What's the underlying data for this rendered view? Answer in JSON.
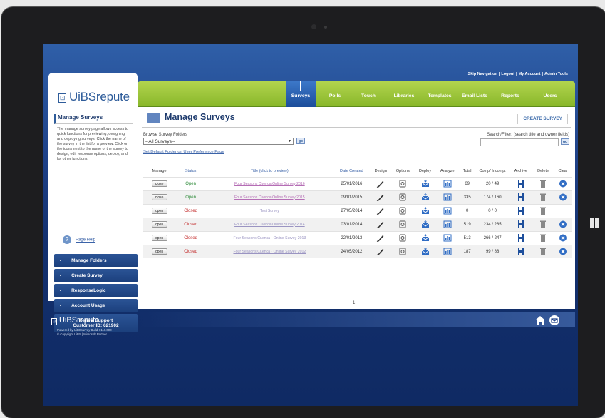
{
  "device": {
    "camera": "camera-dot",
    "os_logo": "windows-logo-icon"
  },
  "top_links": [
    "Skip Navigation",
    "Logout",
    "My Account",
    "Admin Tools"
  ],
  "logo": {
    "text": "UiBSrepute"
  },
  "nav": {
    "items": [
      "Surveys",
      "Polls",
      "Touch",
      "Libraries",
      "Templates",
      "Email Lists",
      "Reports",
      "Users"
    ],
    "active": "Surveys"
  },
  "sidebar": {
    "title": "Manage Surveys",
    "description": "The manage survey page allows access to quick functions for previewing, designing and deploying surveys. Click the name of the survey in the list for a preview. Click on the icons next to the name of the survey to design, edit response options, deploy, and for other functions.",
    "help": "Page Help",
    "menu": [
      "Manage Folders",
      "Create Survey",
      "ResponseLogic",
      "Account Usage"
    ],
    "renew": {
      "label": "Renew Support",
      "customer": "Customer ID: 621902"
    }
  },
  "main": {
    "title": "Manage Surveys",
    "create_button": "CREATE SURVEY",
    "browse_label": "Browse Survey Folders",
    "folder_select": "--All Surveys--",
    "go_label": "go",
    "set_default": "Set Default Folder on User Preference Page",
    "search_label": "Search/Filter: (search title and owner fields)"
  },
  "table": {
    "headers": {
      "manage": "Manage",
      "status": "Status",
      "title": "Title (click to preview)",
      "date": "Date Created",
      "design": "Design",
      "options": "Options",
      "deploy": "Deploy",
      "analyze": "Analyze",
      "total": "Total",
      "comp": "Comp/ Incomp.",
      "archive": "Archive",
      "delete": "Delete",
      "clear": "Clear"
    },
    "rows": [
      {
        "manage": "close",
        "status": "Open",
        "title": "Four Seasons Cuenca Online Survey 2016",
        "date": "25/01/2016",
        "total": "69",
        "comp": "20 / 49",
        "clear": true
      },
      {
        "manage": "close",
        "status": "Open",
        "title": "Four Seasons Cuenca Online Survey 2015",
        "date": "09/01/2015",
        "total": "335",
        "comp": "174 / 160",
        "clear": true
      },
      {
        "manage": "open",
        "status": "Closed",
        "title": "Test Survey",
        "date": "27/05/2014",
        "total": "0",
        "comp": "0 / 0",
        "clear": false
      },
      {
        "manage": "open",
        "status": "Closed",
        "title": "Four Seasons Cuenca Online Survey 2014",
        "date": "03/01/2014",
        "total": "519",
        "comp": "234 / 285",
        "clear": true
      },
      {
        "manage": "open",
        "status": "Closed",
        "title": "Four Seasons Cuenca - Online Survey 2013",
        "date": "22/01/2013",
        "total": "513",
        "comp": "266 / 247",
        "clear": true
      },
      {
        "manage": "open",
        "status": "Closed",
        "title": "Four Seasons Cuenca - Online Survey 2012",
        "date": "24/05/2012",
        "total": "187",
        "comp": "99 / 88",
        "clear": true
      }
    ],
    "pager": "1"
  },
  "footer": {
    "logo": "UiBSrepute",
    "line1": "Powered by UiBSsurvey BuildH.110.000",
    "line2": "© Copyright UiBS | Microsoft Partner",
    "icons": [
      "home-icon",
      "mail-icon"
    ]
  },
  "colors": {
    "nav_green": "#9cc63b",
    "active_blue": "#2a62b3",
    "open": "#2e8b3a",
    "closed": "#c42f2f"
  }
}
